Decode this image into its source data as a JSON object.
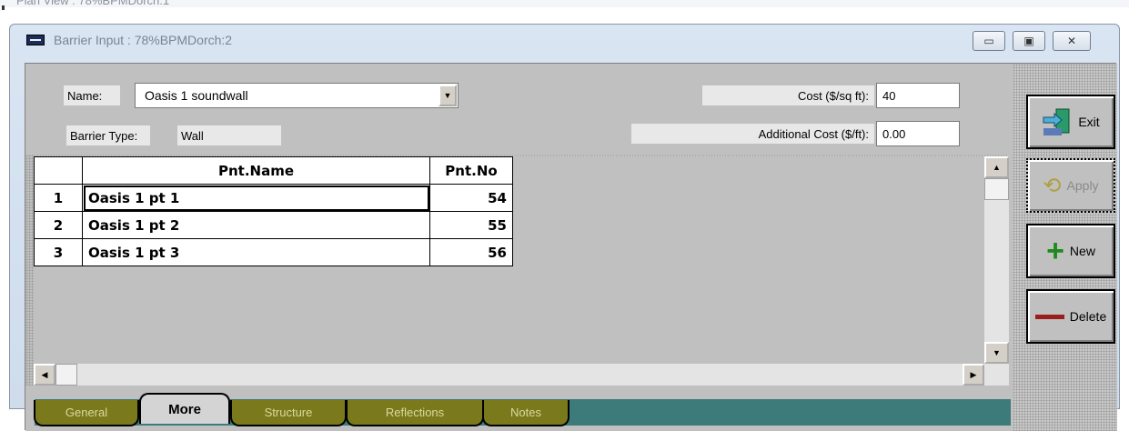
{
  "background_window": {
    "title": "Plan View : 78%BPMDorch:1"
  },
  "window": {
    "title": "Barrier Input : 78%BPMDorch:2",
    "controls": {
      "minimize": "▭",
      "maximize": "▣",
      "close": "✕"
    }
  },
  "form": {
    "name_label": "Name:",
    "name_value": "Oasis 1 soundwall",
    "barrier_type_label": "Barrier Type:",
    "barrier_type_value": "Wall",
    "cost_label": "Cost ($/sq ft):",
    "cost_value": "40",
    "additional_cost_label": "Additional Cost ($/ft):",
    "additional_cost_value": "0.00"
  },
  "grid": {
    "columns": [
      "Pnt.Name",
      "Pnt.No"
    ],
    "rows": [
      {
        "index": "1",
        "name": "Oasis 1 pt 1",
        "no": "54"
      },
      {
        "index": "2",
        "name": "Oasis 1 pt 2",
        "no": "55"
      },
      {
        "index": "3",
        "name": "Oasis 1 pt 3",
        "no": "56"
      }
    ]
  },
  "tabs": [
    {
      "label": "General",
      "active": false
    },
    {
      "label": "More",
      "active": true
    },
    {
      "label": "Structure",
      "active": false
    },
    {
      "label": "Reflections",
      "active": false
    },
    {
      "label": "Notes",
      "active": false
    }
  ],
  "side_buttons": {
    "exit": "Exit",
    "apply": "Apply",
    "new": "New",
    "delete": "Delete"
  },
  "icons": {
    "exit": "exit-door-icon",
    "apply": "apply-arrow-icon",
    "new": "plus-icon",
    "delete": "minus-icon"
  },
  "colors": {
    "tab_strip": "#3d7a7a",
    "tab_inactive": "#7a7a1c",
    "new_icon": "#1e8a1e",
    "delete_icon": "#9a1e1e"
  }
}
